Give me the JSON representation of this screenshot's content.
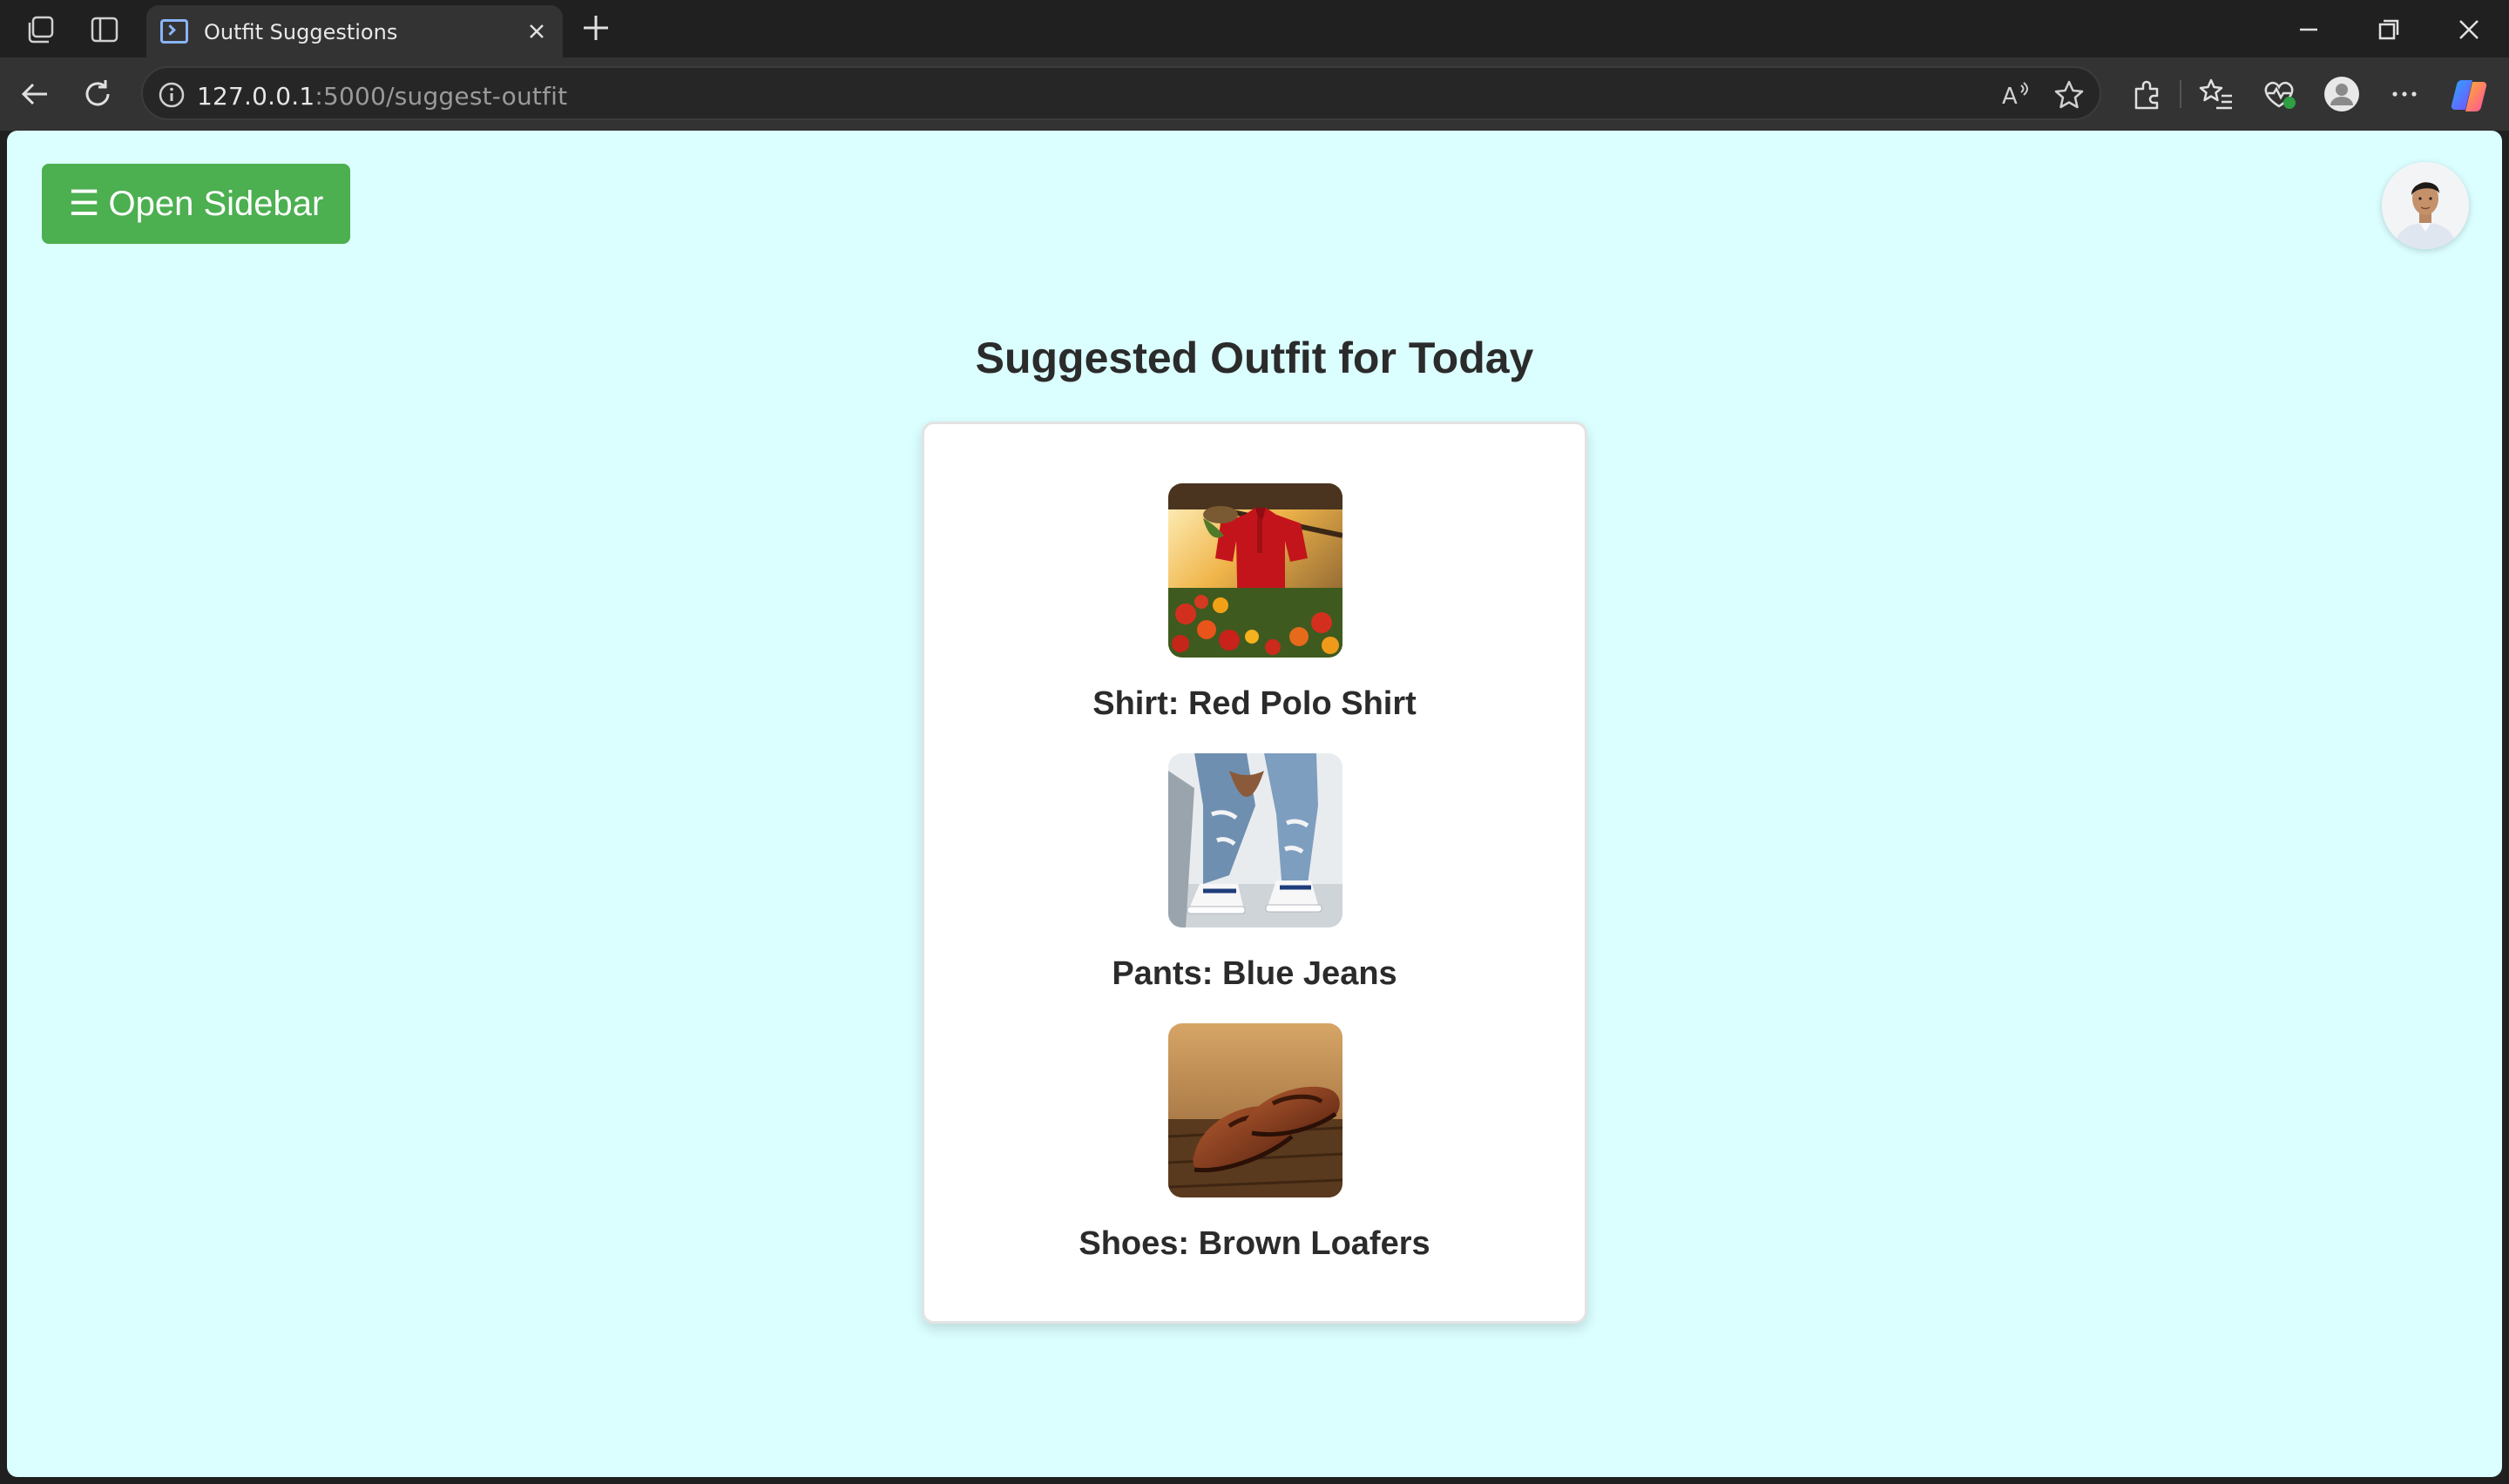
{
  "browser": {
    "tab_title": "Outfit Suggestions",
    "url_host": "127.0.0.1",
    "url_path": ":5000/suggest-outfit"
  },
  "page": {
    "sidebar_button_icon": "☰",
    "sidebar_button_label": "Open Sidebar",
    "title": "Suggested Outfit for Today",
    "items": [
      {
        "label": "Shirt: Red Polo Shirt",
        "image": "red-polo-shirt"
      },
      {
        "label": "Pants: Blue Jeans",
        "image": "blue-jeans"
      },
      {
        "label": "Shoes: Brown Loafers",
        "image": "brown-loafers"
      }
    ]
  },
  "colors": {
    "page_background": "#dbfeff",
    "sidebar_button": "#4caf50",
    "card": "#ffffff"
  }
}
